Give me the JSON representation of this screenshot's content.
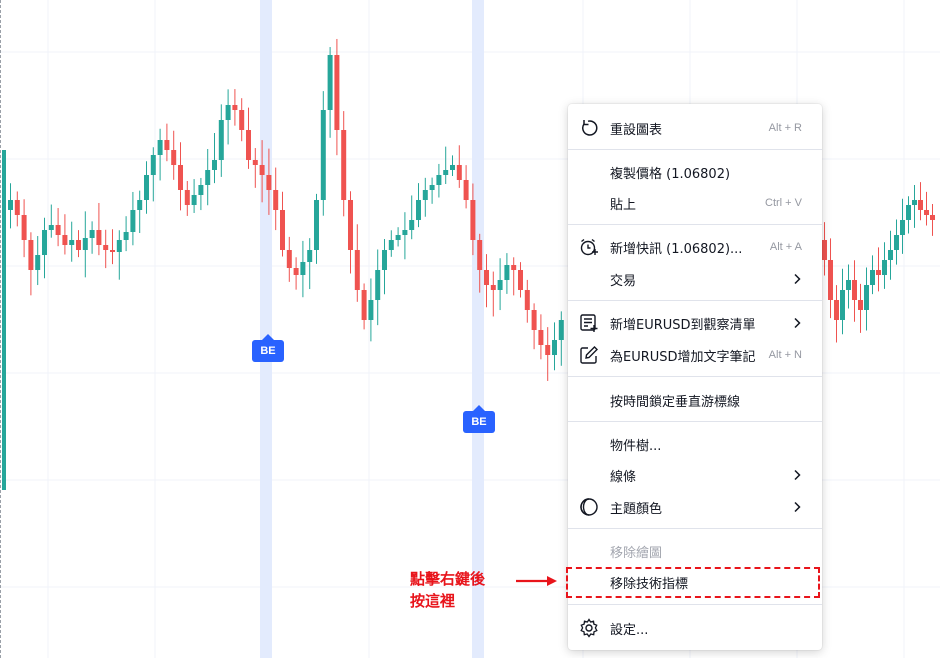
{
  "chart": {
    "badges": [
      {
        "label": "BE"
      },
      {
        "label": "BE"
      }
    ],
    "colors": {
      "up": "#26a69a",
      "down": "#ef5350",
      "grid": "#f0f3fa",
      "highlight": "#e3ebfd",
      "badge": "#2962ff"
    }
  },
  "context_menu": {
    "items": [
      {
        "icon": "reset-icon",
        "label": "重設圖表",
        "shortcut": "Alt + R"
      },
      {
        "icon": "",
        "label": "複製價格 (1.06802)",
        "shortcut": ""
      },
      {
        "icon": "",
        "label": "貼上",
        "shortcut": "Ctrl + V"
      },
      {
        "icon": "add-alert-icon",
        "label": "新增快訊 (1.06802)...",
        "shortcut": "Alt + A"
      },
      {
        "icon": "",
        "label": "交易",
        "shortcut": "",
        "submenu": true
      },
      {
        "icon": "add-watchlist-icon",
        "label": "新增EURUSD到觀察清單",
        "shortcut": "",
        "submenu": true
      },
      {
        "icon": "add-note-icon",
        "label": "為EURUSD增加文字筆記",
        "shortcut": "Alt + N"
      },
      {
        "icon": "",
        "label": "按時間鎖定垂直游標線",
        "shortcut": ""
      },
      {
        "icon": "",
        "label": "物件樹...",
        "shortcut": ""
      },
      {
        "icon": "",
        "label": "線條",
        "shortcut": "",
        "submenu": true
      },
      {
        "icon": "theme-icon",
        "label": "主題顏色",
        "shortcut": "",
        "submenu": true
      },
      {
        "icon": "",
        "label": "移除繪圖",
        "shortcut": "",
        "disabled": true
      },
      {
        "icon": "",
        "label": "移除技術指標",
        "shortcut": ""
      },
      {
        "icon": "settings-icon",
        "label": "設定...",
        "shortcut": ""
      }
    ]
  },
  "annotation": {
    "line1": "點擊右鍵後",
    "line2": "按這裡",
    "color": "#e8141b"
  }
}
